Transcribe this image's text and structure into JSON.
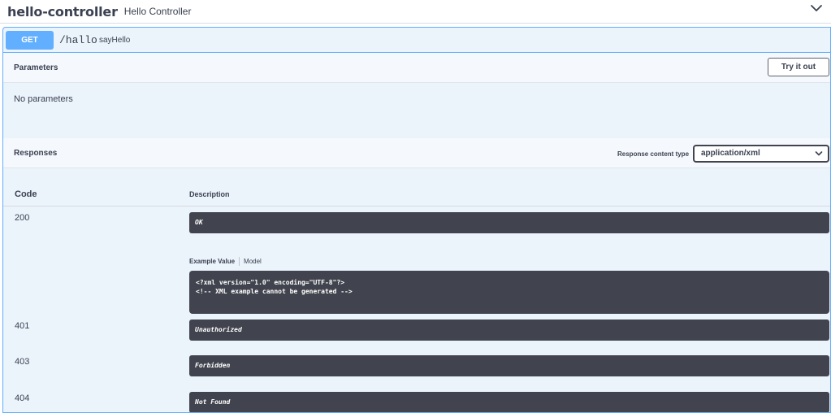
{
  "tag": {
    "name": "hello-controller",
    "description": "Hello Controller",
    "expand_icon": "chevron-down-icon"
  },
  "operation": {
    "method": "GET",
    "path": "/hallo",
    "operation_id": "sayHello",
    "accent_color": "#61affe"
  },
  "parameters": {
    "title": "Parameters",
    "try_it_out_label": "Try it out",
    "empty_text": "No parameters"
  },
  "responses": {
    "title": "Responses",
    "content_type_label": "Response content type",
    "content_type_value": "application/xml",
    "columns": {
      "code": "Code",
      "description": "Description"
    },
    "rows": [
      {
        "code": "200",
        "description": "OK"
      },
      {
        "code": "401",
        "description": "Unauthorized"
      },
      {
        "code": "403",
        "description": "Forbidden"
      },
      {
        "code": "404",
        "description": "Not Found"
      }
    ],
    "example_tabs": {
      "active": "Example Value",
      "inactive": "Model"
    },
    "example_value": "<?xml version=\"1.0\" encoding=\"UTF-8\"?>\n<!-- XML example cannot be generated -->"
  }
}
